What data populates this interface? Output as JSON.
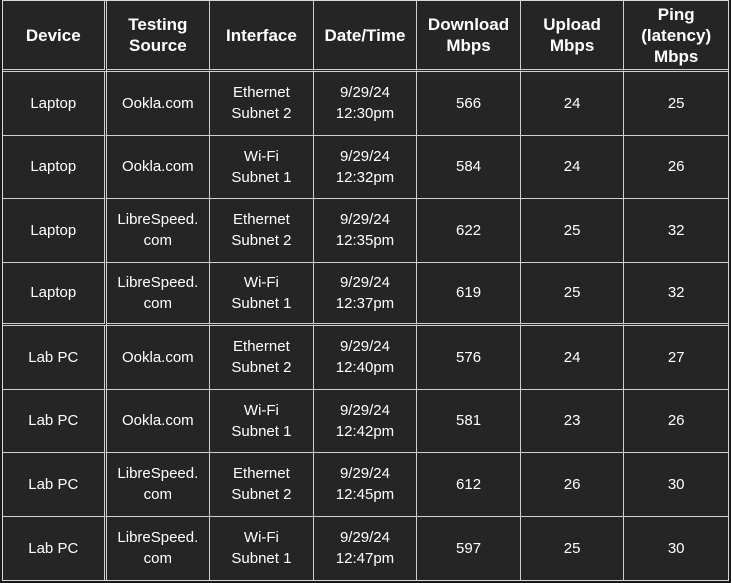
{
  "headers": [
    {
      "key": "device",
      "lines": [
        "Device"
      ]
    },
    {
      "key": "source",
      "lines": [
        "Testing",
        "Source"
      ]
    },
    {
      "key": "interface",
      "lines": [
        "Interface"
      ]
    },
    {
      "key": "datetime",
      "lines": [
        "Date/Time"
      ]
    },
    {
      "key": "download",
      "lines": [
        "Download",
        "Mbps"
      ]
    },
    {
      "key": "upload",
      "lines": [
        "Upload",
        "Mbps"
      ]
    },
    {
      "key": "ping",
      "lines": [
        "Ping",
        "(latency)",
        "Mbps"
      ]
    }
  ],
  "rows": [
    {
      "device": "Laptop",
      "source": [
        "Ookla.com"
      ],
      "interface": [
        "Ethernet",
        "Subnet 2"
      ],
      "datetime": [
        "9/29/24",
        "12:30pm"
      ],
      "download": "566",
      "upload": "24",
      "ping": "25"
    },
    {
      "device": "Laptop",
      "source": [
        "Ookla.com"
      ],
      "interface": [
        "Wi-Fi",
        "Subnet 1"
      ],
      "datetime": [
        "9/29/24",
        "12:32pm"
      ],
      "download": "584",
      "upload": "24",
      "ping": "26"
    },
    {
      "device": "Laptop",
      "source": [
        "LibreSpeed.",
        "com"
      ],
      "interface": [
        "Ethernet",
        "Subnet 2"
      ],
      "datetime": [
        "9/29/24",
        "12:35pm"
      ],
      "download": "622",
      "upload": "25",
      "ping": "32"
    },
    {
      "device": "Laptop",
      "source": [
        "LibreSpeed.",
        "com"
      ],
      "interface": [
        "Wi-Fi",
        "Subnet 1"
      ],
      "datetime": [
        "9/29/24",
        "12:37pm"
      ],
      "download": "619",
      "upload": "25",
      "ping": "32"
    },
    {
      "device": "Lab PC",
      "source": [
        "Ookla.com"
      ],
      "interface": [
        "Ethernet",
        "Subnet 2"
      ],
      "datetime": [
        "9/29/24",
        "12:40pm"
      ],
      "download": "576",
      "upload": "24",
      "ping": "27"
    },
    {
      "device": "Lab PC",
      "source": [
        "Ookla.com"
      ],
      "interface": [
        "Wi-Fi",
        "Subnet 1"
      ],
      "datetime": [
        "9/29/24",
        "12:42pm"
      ],
      "download": "581",
      "upload": "23",
      "ping": "26"
    },
    {
      "device": "Lab PC",
      "source": [
        "LibreSpeed.",
        "com"
      ],
      "interface": [
        "Ethernet",
        "Subnet 2"
      ],
      "datetime": [
        "9/29/24",
        "12:45pm"
      ],
      "download": "612",
      "upload": "26",
      "ping": "30"
    },
    {
      "device": "Lab PC",
      "source": [
        "LibreSpeed.",
        "com"
      ],
      "interface": [
        "Wi-Fi",
        "Subnet 1"
      ],
      "datetime": [
        "9/29/24",
        "12:47pm"
      ],
      "download": "597",
      "upload": "25",
      "ping": "30"
    }
  ]
}
